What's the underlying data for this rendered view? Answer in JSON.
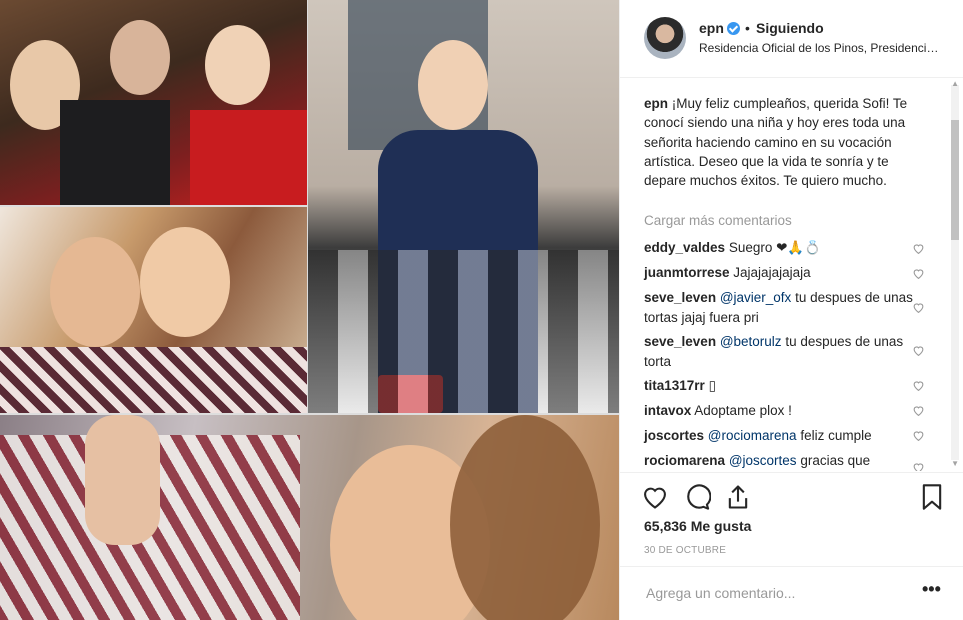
{
  "post": {
    "username": "epn",
    "follow_status": "Siguiendo",
    "separator": "•",
    "location": "Residencia Oficial de los Pinos, Presidencia de la República",
    "caption_user": "epn",
    "caption_text": "¡Muy feliz cumpleaños, querida Sofi! Te conocí siendo una niña y hoy eres toda una señorita haciendo camino en su vocación artística. Deseo que la vida te sonría y te depare muchos éxitos. Te quiero mucho.",
    "load_more": "Cargar más comentarios",
    "comments": [
      {
        "user": "eddy_valdes",
        "text": "Suegro ❤🙏💍"
      },
      {
        "user": "juanmtorrese",
        "text": "Jajajajajajaja"
      },
      {
        "user": "seve_leven",
        "mention": "@javier_ofx",
        "text": "tu despues de unas tortas jajaj fuera pri"
      },
      {
        "user": "seve_leven",
        "mention": "@betorulz",
        "text": "tu despues de unas torta"
      },
      {
        "user": "tita1317rr",
        "text": "▯"
      },
      {
        "user": "intavox",
        "text": "Adoptame plox !"
      },
      {
        "user": "joscortes",
        "mention": "@rociomarena",
        "text": "feliz cumple"
      },
      {
        "user": "rociomarena",
        "mention": "@joscortes",
        "text": "gracias que"
      }
    ],
    "likes": "65,836 Me gusta",
    "date": "30 DE OCTUBRE",
    "add_comment_placeholder": "Agrega un comentario...",
    "more_options": "•••",
    "icons": {
      "verified": "verified-badge-icon",
      "like": "heart-icon",
      "comment": "comment-icon",
      "share": "share-icon",
      "save": "bookmark-icon"
    },
    "colors": {
      "verified": "#3897f0",
      "mention": "#003569",
      "muted": "#999999",
      "text": "#262626"
    }
  }
}
